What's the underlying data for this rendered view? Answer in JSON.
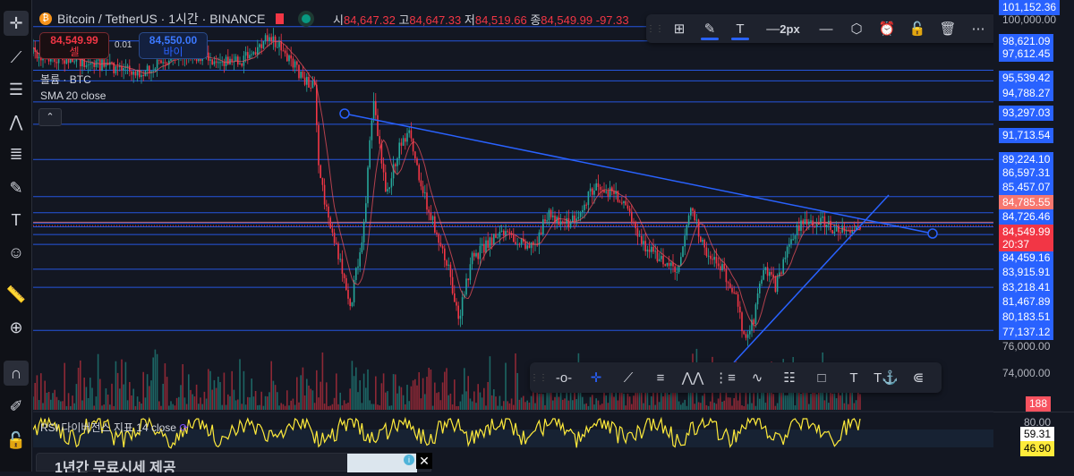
{
  "symbol": {
    "name": "Bitcoin / TetherUS · 1시간 · BINANCE",
    "icon": "bitcoin-icon"
  },
  "ohlc": {
    "o_label": "시",
    "o": "84,647.32",
    "h_label": "고",
    "h": "84,647.33",
    "l_label": "저",
    "l": "84,519.66",
    "c_label": "종",
    "c": "84,549.99",
    "change": "-97.33"
  },
  "trade": {
    "sell_price": "84,549.99",
    "sell_label": "셀",
    "spread": "0.01",
    "buy_price": "84,550.00",
    "buy_label": "바이"
  },
  "indicators": {
    "volume": "볼륨 · BTC",
    "sma": "SMA 20 close",
    "rsi": "RSI 다이버전스 지표 14 close"
  },
  "draw_toolbar": {
    "width_label": "2px",
    "items": [
      "grid-add-icon",
      "pencil-icon",
      "text-icon",
      "line-width-icon",
      "line-style-icon",
      "hexagon-icon",
      "alarm-add-icon",
      "unlock-icon",
      "trash-icon",
      "more-icon"
    ]
  },
  "line_toolbar": {
    "items": [
      "horizontal-ray-icon",
      "crosshair-icon",
      "trendline-icon",
      "parallel-channel-icon",
      "abcd-pattern-icon",
      "fib-channel-icon",
      "elliott-wave-icon",
      "fib-retracement-icon",
      "rectangle-icon",
      "text-icon",
      "anchored-text-icon",
      "pitchfork-icon"
    ]
  },
  "left_toolbar": [
    "crosshair-icon",
    "trendline-icon",
    "horizontal-lines-icon",
    "pattern-icon",
    "fib-icon",
    "brush-icon",
    "text-icon",
    "emoji-icon",
    "ruler-icon",
    "zoom-in-icon",
    "magnet-icon",
    "lock-drawing-icon",
    "unlock-icon"
  ],
  "price_levels": [
    {
      "v": "101,152.36",
      "p": 101152,
      "c": "#2962ff"
    },
    {
      "v": "98,621.09",
      "p": 98621,
      "c": "#2962ff"
    },
    {
      "v": "97,612.45",
      "p": 97612,
      "c": "#2962ff"
    },
    {
      "v": "95,539.42",
      "p": 95539,
      "c": "#2962ff"
    },
    {
      "v": "94,788.27",
      "p": 94788,
      "c": "#2962ff"
    },
    {
      "v": "93,297.03",
      "p": 93297,
      "c": "#2962ff"
    },
    {
      "v": "91,713.54",
      "p": 91713,
      "c": "#2962ff"
    },
    {
      "v": "89,224.10",
      "p": 89224,
      "c": "#2962ff"
    },
    {
      "v": "86,597.31",
      "p": 86597,
      "c": "#2962ff"
    },
    {
      "v": "85,457.07",
      "p": 85457,
      "c": "#2962ff"
    },
    {
      "v": "84,785.55",
      "p": 84785,
      "c": "#f7776f"
    },
    {
      "v": "84,726.46",
      "p": 84726,
      "c": "#2962ff"
    },
    {
      "v": "84,459.16",
      "p": 84459,
      "c": "#2962ff"
    },
    {
      "v": "83,915.91",
      "p": 83915,
      "c": "#2962ff"
    },
    {
      "v": "83,218.41",
      "p": 83218,
      "c": "#2962ff"
    },
    {
      "v": "81,467.89",
      "p": 81467,
      "c": "#2962ff"
    },
    {
      "v": "80,183.51",
      "p": 80183,
      "c": "#2962ff"
    },
    {
      "v": "77,137.12",
      "p": 77137,
      "c": "#2962ff"
    }
  ],
  "axis_ticks": [
    "100,000.00",
    "76,000.00",
    "74,000.00"
  ],
  "current_price": {
    "value": "84,549.99",
    "countdown": "20:37",
    "color": "#f23645"
  },
  "volume_badge": "188",
  "rsi_axis": {
    "top": "80.00",
    "v1": "59.31",
    "v2": "46.90"
  },
  "ad": {
    "title": "1년간 무료시세 제공"
  },
  "colors": {
    "up": "#26a69a",
    "down": "#f23645",
    "line": "#2962ff",
    "rsi": "#ffeb3b"
  }
}
